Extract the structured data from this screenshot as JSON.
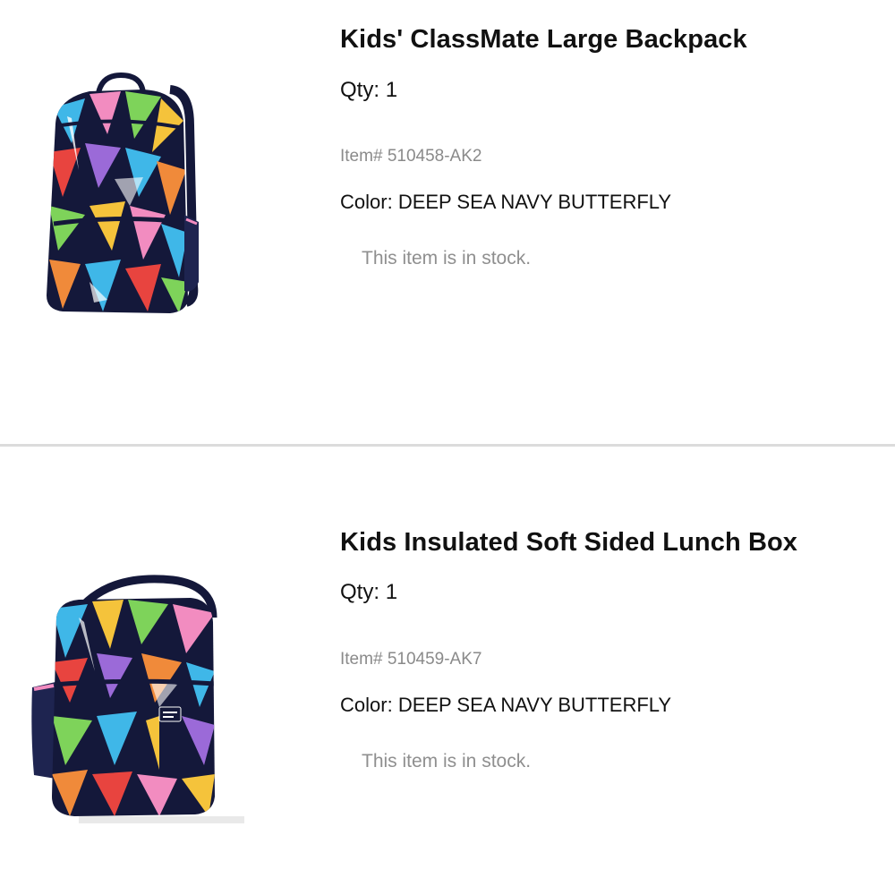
{
  "cart_items": [
    {
      "title": "Kids' ClassMate Large Backpack",
      "qty_label": "Qty:",
      "qty_value": "1",
      "item_label": "Item#",
      "item_number": "510458-AK2",
      "color_label": "Color:",
      "color_value": "DEEP SEA NAVY BUTTERFLY",
      "stock_status": "This item is in stock.",
      "image_icon": "backpack-image"
    },
    {
      "title": "Kids Insulated Soft Sided Lunch Box",
      "qty_label": "Qty:",
      "qty_value": "1",
      "item_label": "Item#",
      "item_number": "510459-AK7",
      "color_label": "Color:",
      "color_value": "DEEP SEA NAVY BUTTERFLY",
      "stock_status": "This item is in stock.",
      "image_icon": "lunch-box-image"
    }
  ],
  "colors": {
    "pattern_navy": "#14183a",
    "pattern_accents": [
      "#3fb7e8",
      "#e8443f",
      "#f5c33b",
      "#7ed35a",
      "#f28cc0",
      "#9b6ad8",
      "#f08a3a",
      "#ffffff"
    ],
    "divider": "#dcdcdc",
    "muted_text": "#8a8a8a"
  }
}
